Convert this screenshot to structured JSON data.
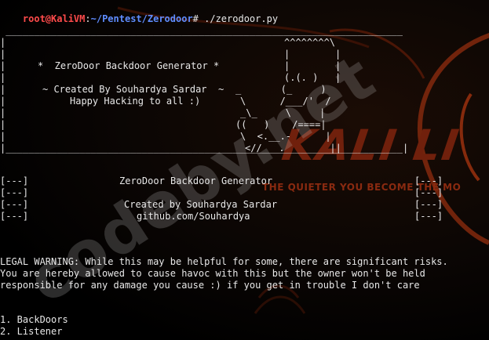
{
  "prompt": {
    "user_host": "root@KaliVM",
    "separator": ":",
    "path": "~/Pentest/Zerodoor",
    "symbol": "#",
    "command": " ./zerodoor.py"
  },
  "banner": {
    "top_rule": " ______________________________________________________________________",
    "bottom_rule": "|______________________________________________________________________|",
    "title": "*  ZeroDoor Backdoor Generator *",
    "created_by": "~ Created By Souhardya Sardar  ~",
    "hacking": "Happy Hacking to all :)",
    "art": [
      "^^^^^^^^\\",
      "|        |",
      "|        |",
      "(.(. )   |",
      "_       (_     )",
      "\\      /___/'  /",
      "_\\_     \\     |",
      "((   )    /====|",
      "\\  <.__.-      |",
      "<//___.        ||"
    ]
  },
  "info_block": {
    "left_tags": [
      "[---]",
      "[---]",
      "[---]",
      "[---]"
    ],
    "right_tags": [
      "[---]",
      "[---]",
      "[---]",
      "[---]"
    ],
    "title": "ZeroDoor Backdoor Generator",
    "created_by": "Created by Souhardya Sardar",
    "github": "github.com/Souhardya"
  },
  "legal_warning": [
    "LEGAL WARNING: While this may be helpful for some, there are significant risks.",
    "You are hereby allowed to cause havoc with this but the owner won't be held",
    "responsible for any damage you cause :) if you get in trouble I don't care"
  ],
  "menu": {
    "items": [
      "1. BackDoors",
      "2. Listener"
    ]
  },
  "wallpaper": {
    "brand": "KALI LI",
    "tagline": "THE QUIETER YOU BECOME                  THE MO",
    "watermark": "codeby.net",
    "accent_color": "#c2410c",
    "text_color": "#e8e8e8",
    "prompt_user_color": "#ff4b4b",
    "prompt_path_color": "#5f8dff"
  }
}
